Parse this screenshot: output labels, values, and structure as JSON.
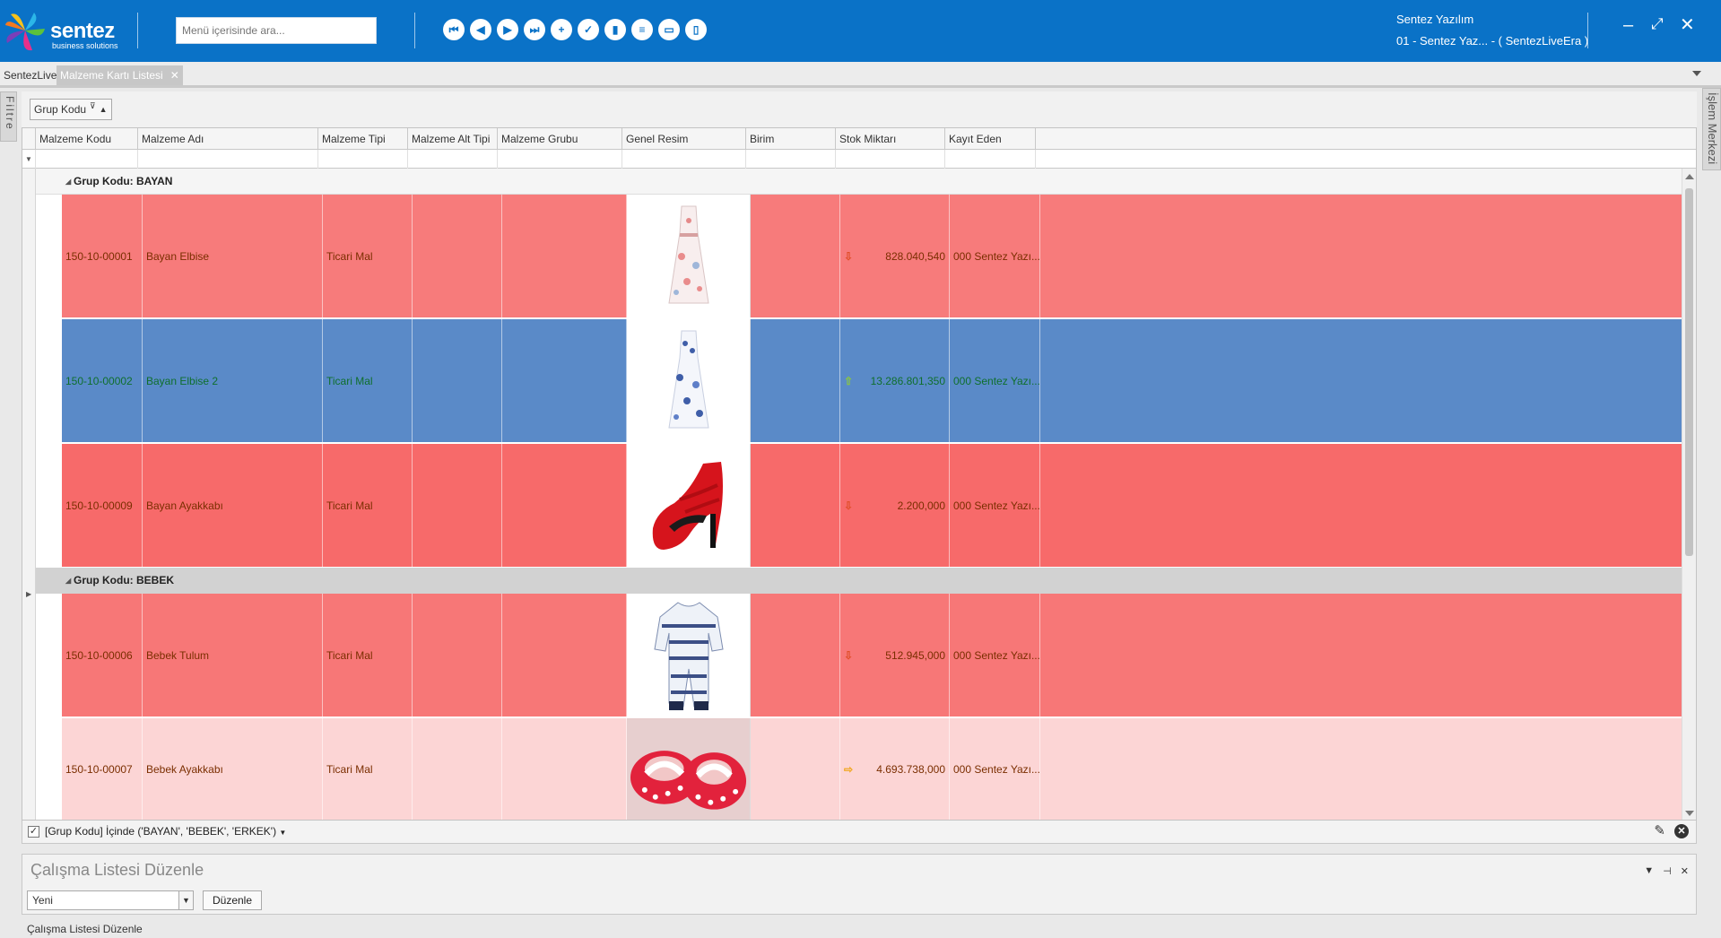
{
  "header": {
    "logo_text": "sentez",
    "logo_sub": "business solutions",
    "search_placeholder": "Menü içerisinde ara...",
    "user_name": "Sentez Yazılım",
    "company": "01 - Sentez Yaz... - ( SentezLiveEra )",
    "nav_icons": [
      "first-icon",
      "prev-icon",
      "next-icon",
      "last-icon",
      "add-icon",
      "check-icon",
      "delete-icon",
      "list-icon",
      "window-icon",
      "trash-icon"
    ]
  },
  "tabs": {
    "home": "SentezLive",
    "active": "Malzeme Kartı Listesi",
    "close": "✕"
  },
  "side": {
    "filter": "Filtre",
    "right": "İşlem Merkezi"
  },
  "group_panel": {
    "chip": "Grup Kodu"
  },
  "columns": {
    "code": "Malzeme Kodu",
    "name": "Malzeme Adı",
    "type": "Malzeme Tipi",
    "subtype": "Malzeme Alt Tipi",
    "group": "Malzeme Grubu",
    "image": "Genel Resim",
    "unit": "Birim",
    "stock": "Stok Miktarı",
    "recorder": "Kayıt Eden"
  },
  "groups": [
    {
      "label": "Grup Kodu: BAYAN",
      "rows": [
        {
          "code": "150-10-00001",
          "name": "Bayan Elbise",
          "type": "Ticari Mal",
          "stock": "828.040,540",
          "recorder": "000 Sentez Yazı...",
          "arrow": "down",
          "image": "dress-floral",
          "bg": "#f77b7b"
        },
        {
          "code": "150-10-00002",
          "name": "Bayan Elbise 2",
          "type": "Ticari Mal",
          "stock": "13.286.801,350",
          "recorder": "000 Sentez Yazı...",
          "arrow": "up",
          "image": "dress-blue",
          "bg": "#5a8ac8"
        },
        {
          "code": "150-10-00009",
          "name": "Bayan Ayakkabı",
          "type": "Ticari Mal",
          "stock": "2.200,000",
          "recorder": "000 Sentez Yazı...",
          "arrow": "down",
          "image": "red-heel",
          "bg": "#f76a6a"
        }
      ]
    },
    {
      "label": "Grup Kodu: BEBEK",
      "rows": [
        {
          "code": "150-10-00006",
          "name": "Bebek Tulum",
          "type": "Ticari Mal",
          "stock": "512.945,000",
          "recorder": "000 Sentez Yazı...",
          "arrow": "down",
          "image": "baby-jumpsuit",
          "bg": "#f77777"
        },
        {
          "code": "150-10-00007",
          "name": "Bebek Ayakkabı",
          "type": "Ticari Mal",
          "stock": "4.693.738,000",
          "recorder": "000 Sentez Yazı...",
          "arrow": "right",
          "image": "baby-shoes",
          "bg": "#fcd5d5"
        }
      ]
    }
  ],
  "filter_bar": {
    "text": "[Grup Kodu] İçinde ('BAYAN', 'BEBEK', 'ERKEK')",
    "checked": true
  },
  "work_panel": {
    "title": "Çalışma Listesi Düzenle",
    "select_value": "Yeni",
    "button": "Düzenle"
  },
  "footer": {
    "text": "Çalışma Listesi Düzenle"
  },
  "colors": {
    "header_bg": "#0a72c7",
    "text_on_red": "#7a2e00",
    "text_on_blue": "#0f6f2c",
    "arrow_down": "#e04f2a",
    "arrow_up": "#8cc83c",
    "arrow_right": "#f0a61c"
  }
}
